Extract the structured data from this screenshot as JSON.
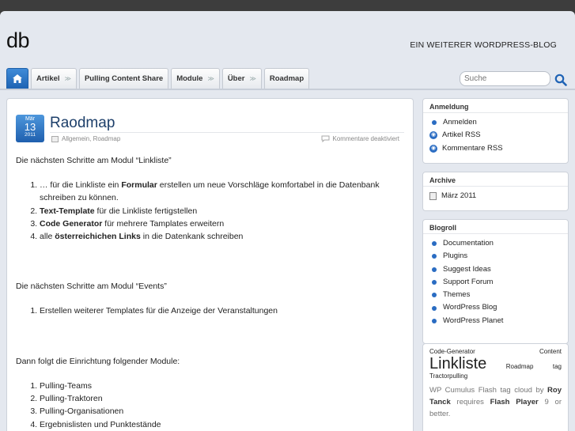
{
  "site": {
    "logo": "db",
    "tagline": "EIN WEITERER WORDPRESS-BLOG"
  },
  "nav": {
    "items": [
      {
        "label": "Artikel",
        "dropdown": true
      },
      {
        "label": "Pulling Content Share",
        "dropdown": false
      },
      {
        "label": "Module",
        "dropdown": true
      },
      {
        "label": "Über",
        "dropdown": true
      },
      {
        "label": "Roadmap",
        "dropdown": false
      }
    ],
    "chevron": "≫"
  },
  "search": {
    "placeholder": "Suche"
  },
  "post": {
    "date": {
      "month": "Mär",
      "day": "13",
      "year": "2011"
    },
    "title": "Raodmap",
    "categories": "Allgemein, Roadmap",
    "comments": "Kommentare deaktiviert",
    "intro1": "Die nächsten Schritte am Modul “Linkliste”",
    "list1": {
      "i1a": "… für die Linkliste ein ",
      "i1b": "Formular",
      "i1c": " erstellen um neue Vorschläge komfortabel in die Datenbank schreiben zu können.",
      "i2a": "Text-Template",
      "i2b": " für die Linkliste fertigstellen",
      "i3a": "Code Generator",
      "i3b": " für mehrere Tamplates erweitern",
      "i4a": "alle ",
      "i4b": "österreichichen Links",
      "i4c": " in die Datenkank schreiben"
    },
    "intro2": "Die nächsten Schritte am Modul “Events”",
    "list2": [
      "Erstellen weiterer Templates für die Anzeige der Veranstaltungen"
    ],
    "intro3": "Dann folgt die Einrichtung folgender Module:",
    "list3": [
      "Pulling-Teams",
      "Pulling-Traktoren",
      "Pulling-Organisationen",
      "Ergebnislisten und Punktestände"
    ]
  },
  "sidebar": {
    "login": {
      "title": "Anmeldung",
      "items": [
        "Anmelden",
        "Artikel RSS",
        "Kommentare RSS"
      ]
    },
    "archive": {
      "title": "Archive",
      "items": [
        "März 2011"
      ]
    },
    "blogroll": {
      "title": "Blogroll",
      "items": [
        "Documentation",
        "Plugins",
        "Suggest Ideas",
        "Support Forum",
        "Themes",
        "WordPress Blog",
        "WordPress Planet"
      ]
    },
    "tags": {
      "t1": "Code-Generator",
      "t2": "Content",
      "t3": "Linkliste",
      "t4": "Roadmap",
      "t5": "tag",
      "t6": "Tractorpulling",
      "wpc1": "WP Cumulus Flash tag cloud by ",
      "wpc2": "Roy Tanck",
      "wpc3": " requires ",
      "wpc4": "Flash Player",
      "wpc5": " 9 or better."
    }
  },
  "colors": {
    "accent": "#2a6cc2",
    "title": "#1d3f6a",
    "background": "#e4e8ef"
  }
}
